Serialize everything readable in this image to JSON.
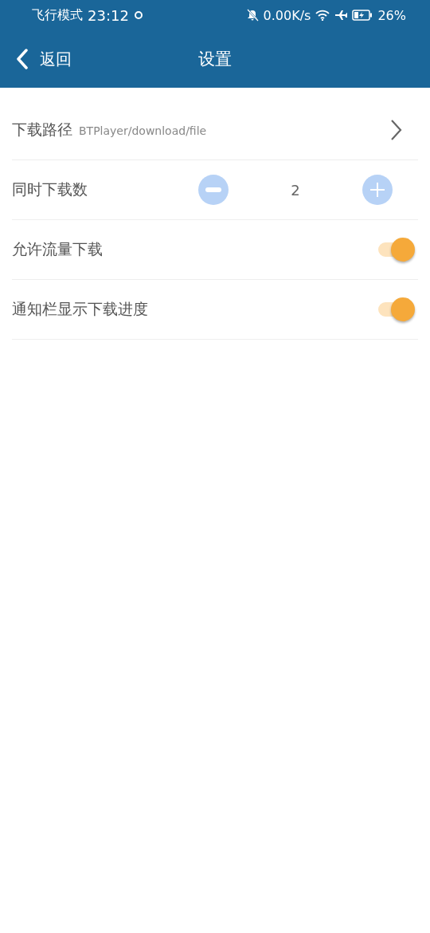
{
  "status_bar": {
    "mode": "飞行模式",
    "time": "23:12",
    "speed": "0.00K/s",
    "battery": "26%"
  },
  "header": {
    "back": "返回",
    "title": "设置"
  },
  "settings": [
    {
      "kind": "path",
      "label": "下载路径",
      "value": "BTPlayer/download/file"
    },
    {
      "kind": "stepper",
      "label": "同时下载数",
      "value": "2"
    },
    {
      "kind": "toggle",
      "label": "允许流量下载",
      "on": true
    },
    {
      "kind": "toggle",
      "label": "通知栏显示下载进度",
      "on": true
    }
  ]
}
